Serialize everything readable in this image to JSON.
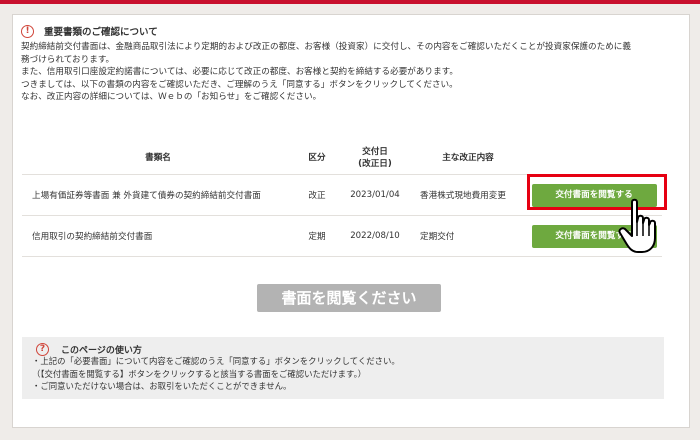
{
  "notice": {
    "title": "重要書類のご確認について",
    "lines": [
      "契約締結前交付書面は、金融商品取引法により定期的および改正の都度、お客様（投資家）に交付し、その内容をご確認いただくことが投資家保護のために義",
      "務づけられております。",
      "また、信用取引口座設定約諾書については、必要に応じて改正の都度、お客様と契約を締結する必要があります。",
      "つきましては、以下の書類の内容をご確認いただき、ご理解のうえ「同意する」ボタンをクリックしてください。",
      "なお、改正内容の詳細については、Ｗｅｂの「お知らせ」をご確認ください。"
    ]
  },
  "table": {
    "headers": {
      "name": "書類名",
      "kind": "区分",
      "date_l1": "交付日",
      "date_l2": "(改正日)",
      "change": "主な改正内容"
    },
    "rows": [
      {
        "name": "上場有価証券等書面 兼 外貨建て債券の契約締結前交付書面",
        "kind": "改正",
        "date": "2023/01/04",
        "change": "香港株式現地費用変更",
        "button": "交付書面を閲覧する"
      },
      {
        "name": "信用取引の契約締結前交付書面",
        "kind": "定期",
        "date": "2022/08/10",
        "change": "定期交付",
        "button": "交付書面を閲覧する"
      }
    ]
  },
  "big_button": "書面を閲覧ください",
  "howto": {
    "title": "このページの使い方",
    "lines": [
      "・上記の「必要書面」について内容をご確認のうえ「同意する」ボタンをクリックしてください。",
      "（【交付書面を閲覧する】ボタンをクリックすると該当する書面をご確認いただけます。）",
      "・ご同意いただけない場合は、お取引をいただくことができません。"
    ]
  },
  "colors": {
    "accent_red": "#e60012",
    "button_green": "#6ea93f",
    "disabled_gray": "#b3b3b3",
    "top_bar": "#c8102e"
  },
  "icons": {
    "notice": "exclamation-circle-icon",
    "howto": "question-circle-icon",
    "pointer": "pointing-hand-cursor-icon"
  }
}
